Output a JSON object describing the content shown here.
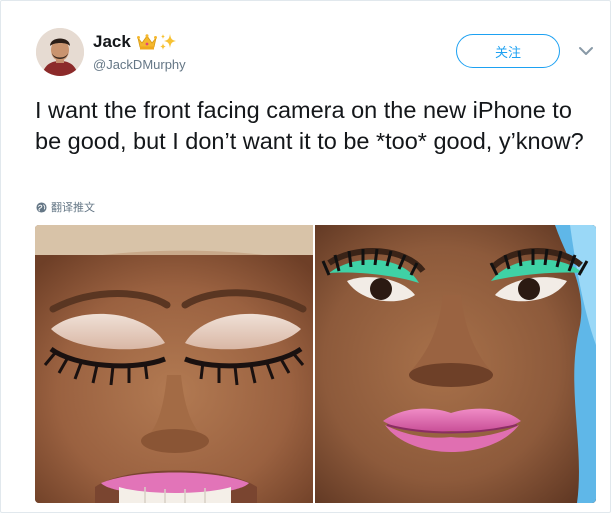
{
  "user": {
    "name": "Jack",
    "handle": "@JackDMurphy",
    "badges": [
      "crown-emoji",
      "sparkles-emoji"
    ]
  },
  "follow_label": "关注",
  "tweet": {
    "text": "I want the front facing camera on the new iPhone to be good, but I don’t want it to be *too* good, y’know?",
    "translate_label": "翻译推文"
  },
  "media": {
    "count": 2,
    "photos": [
      "close-up face, eyes closed, smiling",
      "close-up face, green eyeliner, pursed pink lips"
    ]
  },
  "colors": {
    "accent": "#1da1f2",
    "text": "#14171a",
    "secondary": "#657786",
    "border": "#e1e8ed"
  }
}
